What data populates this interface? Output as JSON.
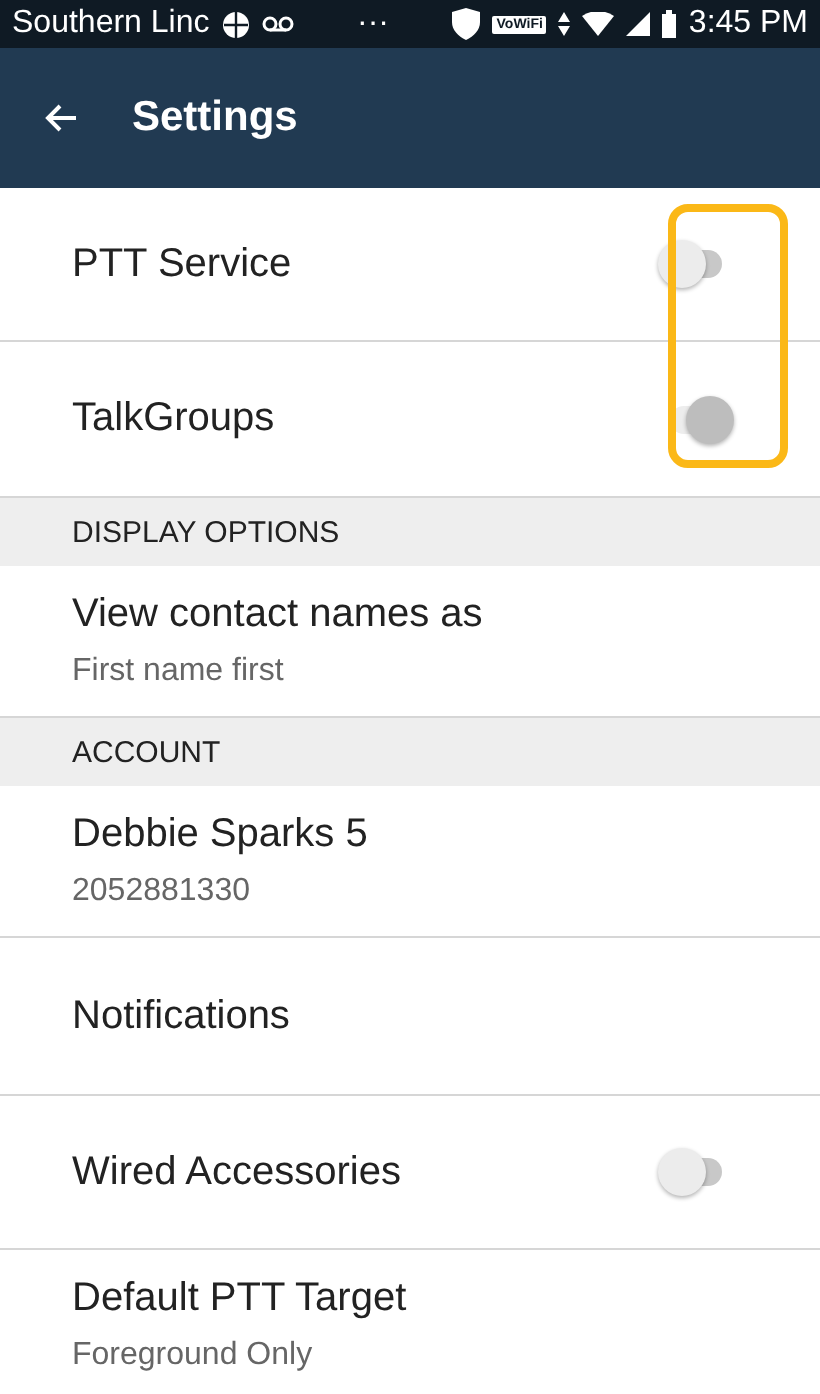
{
  "status_bar": {
    "carrier": "Southern Linc",
    "dots": "···",
    "vowifi": "VoWiFi",
    "time": "3:45 PM"
  },
  "app_bar": {
    "title": "Settings"
  },
  "highlight_toggles": true,
  "items": [
    {
      "kind": "toggle",
      "label": "PTT Service",
      "on": false,
      "disabled": true
    },
    {
      "kind": "toggle",
      "label": "TalkGroups",
      "on": true,
      "disabled": true
    },
    {
      "kind": "header",
      "label": "DISPLAY OPTIONS"
    },
    {
      "kind": "detail",
      "label": "View contact names as",
      "value": "First name first"
    },
    {
      "kind": "header",
      "label": "ACCOUNT"
    },
    {
      "kind": "detail",
      "label": "Debbie Sparks 5",
      "value": "2052881330"
    },
    {
      "kind": "plain",
      "label": "Notifications"
    },
    {
      "kind": "toggle",
      "label": "Wired Accessories",
      "on": false,
      "disabled": true
    },
    {
      "kind": "detail",
      "label": "Default PTT Target",
      "value": "Foreground Only"
    }
  ]
}
